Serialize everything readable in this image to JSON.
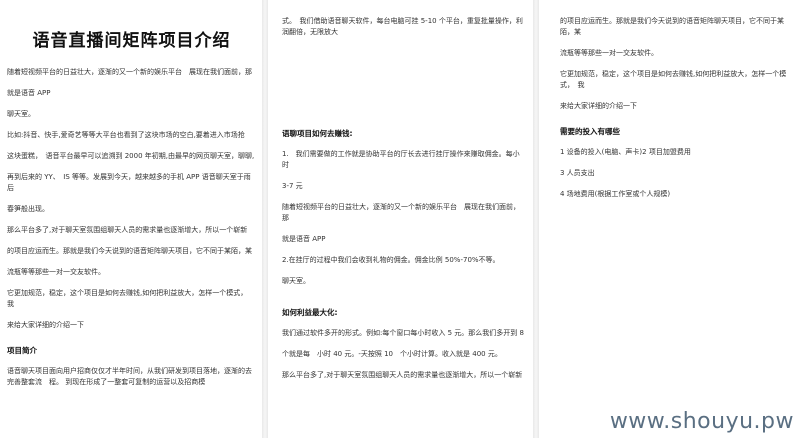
{
  "document": {
    "title": "语音直播间矩阵项目介绍",
    "col1": {
      "p1": "随着短视频平台的日益壮大，逐渐的又一个新的娱乐平台　展现在我们面前，那",
      "p2": "就是语音 APP",
      "p3": "聊天室。",
      "p4": "比如:抖音、快手,爱奇艺等等大平台也看到了这块市场的空白,要着进入市场抢",
      "p5": "这块蛋糕，　语音平台最早可以追溯到 2000 年初期,由最早的网页聊天室，聊聊,",
      "p6": "再到后来的 YY、　IS 等等。发展到今天，越来越多的手机 APP 语音聊天室于雨后",
      "p7": "春笋般出现。",
      "p8": "那么平台多了,对于聊天室氛围组聊天人员的需求量也逐渐增大，所以一个崭新",
      "p9": "的项目应运而生。那就是我们今天说到的语音矩阵聊天项目，它不同于某陌，某",
      "p10": "流瓶等等那些一对一交友软件。",
      "p11": "它更加规范，稳定，这个项目是如何去赚钱,如何把利益放大，怎样一个模式，　我",
      "p12": "来给大家详细的介绍一下",
      "h1": "项目简介",
      "p13": "语音聊天项目面向用户招商仅仅才半年时间，从我们研发到项目落地，逐渐的去完善整套流　程。 到现在形成了一整套可复制的运营以及招商模"
    },
    "col2": {
      "p1": "式。　我们借助语音聊天软件，每台电脑可挂 5-10 个平台，重复批量操作，利润翻倍，无限放大",
      "h1": "语聊项目如何去赚钱:",
      "p2": "1.　我们需要做的工作就是协助平台的厅长去进行挂厅操作来赚取佣金。每小时",
      "p3": "3-7 元",
      "p4": "随着短视频平台的日益壮大，逐渐的又一个新的娱乐平台　展现在我们面前，那",
      "p5": "就是语音 APP",
      "p6": "2.在挂厅的过程中我们会收到礼物的佣金。佣金比例 50%-70%不等。",
      "p7": "聊天室。",
      "h2": "如何利益最大化:",
      "p8": "我们通过软件多开的形式。例如:每个窗口每小时收入 5 元。那么我们多开到 8",
      "p9": "个就是每　小时 40 元。-天按照 10　个小时计算。收入就是 400 元。",
      "p10": "那么平台多了,对于聊天室氛围组聊天人员的需求量也逐渐增大，所以一个崭新"
    },
    "col3": {
      "p1": "的项目应运而生。那就是我们今天说到的语音矩阵聊天项目，它不同于某陌，某",
      "p2": "流瓶等等那些一对一交友软件。",
      "p3": "它更加规范，稳定，这个项目是如何去赚钱,如何把利益放大，怎样一个模式，　我",
      "p4": "来给大家详细的介绍一下",
      "h1": "需要的投入有哪些",
      "p5": "1 设备的投入(电脑、声卡)2 项目加盟费用",
      "p6": "3 人员支出",
      "p7": "4 场地费用(根据工作室或个人规模)"
    }
  },
  "watermark": "www.shouyu.pw"
}
